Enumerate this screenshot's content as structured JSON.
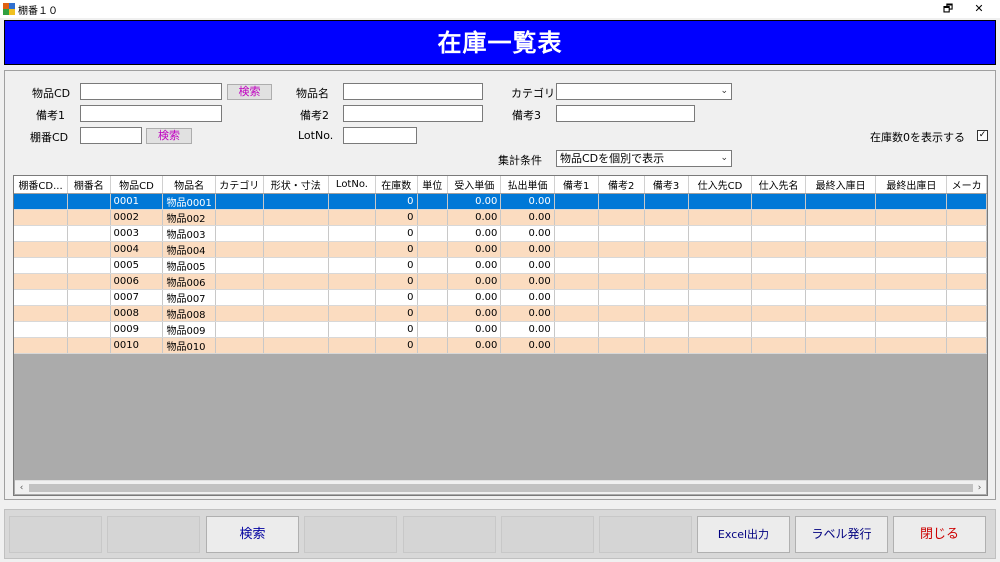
{
  "window": {
    "title": "棚番１０",
    "restore_glyph": "🗗",
    "close_glyph": "✕"
  },
  "header": {
    "title": "在庫一覧表"
  },
  "form": {
    "item_cd_label": "物品CD",
    "item_name_label": "物品名",
    "category_label": "カテゴリ",
    "note1_label": "備考1",
    "note2_label": "備考2",
    "note3_label": "備考3",
    "shelf_cd_label": "棚番CD",
    "lot_label": "LotNo.",
    "search_btn": "検索",
    "show_zero_label": "在庫数0を表示する",
    "show_zero_checked": true,
    "check_glyph": "✓",
    "agg_label": "集計条件",
    "agg_value": "物品CDを個別で表示",
    "dropdown_glyph": "⌄"
  },
  "grid": {
    "columns": [
      "棚番CD...",
      "棚番名",
      "物品CD",
      "物品名",
      "カテゴリ",
      "形状・寸法",
      "LotNo.",
      "在庫数",
      "単位",
      "受入単価",
      "払出単価",
      "備考1",
      "備考2",
      "備考3",
      "仕入先CD",
      "仕入先名",
      "最終入庫日",
      "最終出庫日",
      "メーカ"
    ],
    "rows": [
      [
        "",
        "",
        "0001",
        "物品0001",
        "",
        "",
        "",
        "0",
        "",
        "0.00",
        "0.00",
        "",
        "",
        "",
        "",
        "",
        "",
        "",
        ""
      ],
      [
        "",
        "",
        "0002",
        "物品002",
        "",
        "",
        "",
        "0",
        "",
        "0.00",
        "0.00",
        "",
        "",
        "",
        "",
        "",
        "",
        "",
        ""
      ],
      [
        "",
        "",
        "0003",
        "物品003",
        "",
        "",
        "",
        "0",
        "",
        "0.00",
        "0.00",
        "",
        "",
        "",
        "",
        "",
        "",
        "",
        ""
      ],
      [
        "",
        "",
        "0004",
        "物品004",
        "",
        "",
        "",
        "0",
        "",
        "0.00",
        "0.00",
        "",
        "",
        "",
        "",
        "",
        "",
        "",
        ""
      ],
      [
        "",
        "",
        "0005",
        "物品005",
        "",
        "",
        "",
        "0",
        "",
        "0.00",
        "0.00",
        "",
        "",
        "",
        "",
        "",
        "",
        "",
        ""
      ],
      [
        "",
        "",
        "0006",
        "物品006",
        "",
        "",
        "",
        "0",
        "",
        "0.00",
        "0.00",
        "",
        "",
        "",
        "",
        "",
        "",
        "",
        ""
      ],
      [
        "",
        "",
        "0007",
        "物品007",
        "",
        "",
        "",
        "0",
        "",
        "0.00",
        "0.00",
        "",
        "",
        "",
        "",
        "",
        "",
        "",
        ""
      ],
      [
        "",
        "",
        "0008",
        "物品008",
        "",
        "",
        "",
        "0",
        "",
        "0.00",
        "0.00",
        "",
        "",
        "",
        "",
        "",
        "",
        "",
        ""
      ],
      [
        "",
        "",
        "0009",
        "物品009",
        "",
        "",
        "",
        "0",
        "",
        "0.00",
        "0.00",
        "",
        "",
        "",
        "",
        "",
        "",
        "",
        ""
      ],
      [
        "",
        "",
        "0010",
        "物品010",
        "",
        "",
        "",
        "0",
        "",
        "0.00",
        "0.00",
        "",
        "",
        "",
        "",
        "",
        "",
        "",
        ""
      ]
    ],
    "scroll_left": "‹",
    "scroll_right": "›"
  },
  "footer": {
    "buttons": [
      "",
      "",
      "検索",
      "",
      "",
      "",
      "",
      "Excel出力",
      "ラベル発行",
      "閉じる"
    ],
    "colors": [
      "#000",
      "#000",
      "#0000a0",
      "#000",
      "#000",
      "#000",
      "#000",
      "#000080",
      "#000080",
      "#cc0000"
    ]
  },
  "colors": {
    "header_bg": "#0000ff",
    "row_even": "#fbdcc0",
    "selected_row": "#0078d7",
    "search_btn_text": "#c000c0"
  }
}
